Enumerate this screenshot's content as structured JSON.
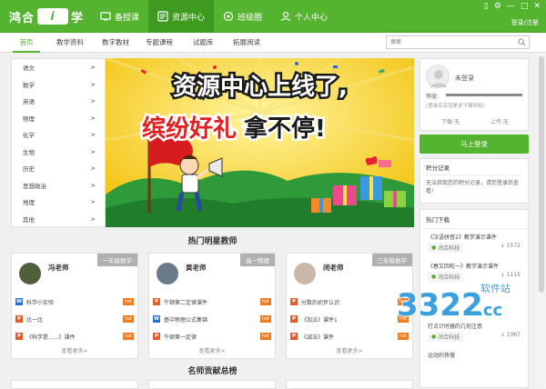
{
  "app": {
    "logo_left": "鸿合",
    "logo_badge": "i",
    "logo_right": "学",
    "nav": [
      {
        "label": "备授课",
        "icon": "teaching-icon"
      },
      {
        "label": "资源中心",
        "icon": "resource-icon"
      },
      {
        "label": "班级圈",
        "icon": "class-circle-icon"
      },
      {
        "label": "个人中心",
        "icon": "person-icon"
      }
    ],
    "login_link": "登录/注册"
  },
  "subnav": {
    "tabs": [
      "首页",
      "教学资料",
      "数字教材",
      "专题课程",
      "试题库",
      "拓展阅读"
    ],
    "search_placeholder": "搜索"
  },
  "subjects": [
    {
      "label": "语文",
      "arrow": ">"
    },
    {
      "label": "数学",
      "arrow": ">"
    },
    {
      "label": "英语",
      "arrow": ">"
    },
    {
      "label": "物理",
      "arrow": ">"
    },
    {
      "label": "化学",
      "arrow": ">"
    },
    {
      "label": "生物",
      "arrow": ">"
    },
    {
      "label": "历史",
      "arrow": ">"
    },
    {
      "label": "思想政治",
      "arrow": ">"
    },
    {
      "label": "地理",
      "arrow": ">"
    },
    {
      "label": "其他",
      "arrow": ">"
    }
  ],
  "banner": {
    "line1": "资源中心上线了,",
    "line2_red": "缤纷好礼",
    "line2_black": "拿不停!"
  },
  "user": {
    "status": "未登录",
    "level_label": "等级:",
    "hint": "(登录后享受更多下载特权)",
    "downloads": "下载:无",
    "uploads": "上传:无",
    "login_button": "马上登录"
  },
  "points": {
    "title": "积分记录",
    "text": "无法获取您的积分记录，请您登录后查看!"
  },
  "hot_downloads": {
    "title": "热门下载",
    "items": [
      {
        "title": "《汉语拼音2》教学演示课件",
        "publisher": "鸿合科技",
        "count": "1572"
      },
      {
        "title": "《春又回啦一》教学演示课件",
        "publisher": "鸿合科技",
        "count": "1115"
      },
      {
        "title": "打点计时器的几何注意",
        "publisher": "鸿合科技",
        "count": "1067"
      },
      {
        "title": "运动的快慢",
        "publisher": "",
        "count": ""
      }
    ]
  },
  "teachers_section_title": "热门明星教师",
  "contrib_section_title": "名师贡献总榜",
  "teachers": [
    {
      "name": "冯老师",
      "grade": "一年级数学",
      "files": [
        {
          "type": "W",
          "title": "科学小实验",
          "hot": "hot"
        },
        {
          "type": "P",
          "title": "比一比",
          "hot": "hot"
        },
        {
          "type": "P",
          "title": "《科学是......》课件",
          "hot": "hot"
        }
      ],
      "more": "查看更多>"
    },
    {
      "name": "黄老师",
      "grade": "高一物理",
      "files": [
        {
          "type": "P",
          "title": "牛顿第二定律课件",
          "hot": "hot"
        },
        {
          "type": "W",
          "title": "基中物理公式集锦",
          "hot": "hot"
        },
        {
          "type": "P",
          "title": "牛顿第一定律",
          "hot": "hot"
        }
      ],
      "more": "查看更多>"
    },
    {
      "name": "闭老师",
      "grade": "三年级数学",
      "files": [
        {
          "type": "P",
          "title": "分数的初步认识",
          "hot": "hot"
        },
        {
          "type": "P",
          "title": "《加法》课件1",
          "hot": "hot"
        },
        {
          "type": "P",
          "title": "《减法》课件",
          "hot": "hot"
        }
      ],
      "more": "查看更多>"
    }
  ],
  "watermark": {
    "big": "3322",
    "cc": ".cc",
    "small": "软件站"
  },
  "colors": {
    "brand_green": "#54b32f",
    "hot_orange": "#f07b1f",
    "banner_yellow": "#f5cf14",
    "banner_red": "#e02020"
  }
}
